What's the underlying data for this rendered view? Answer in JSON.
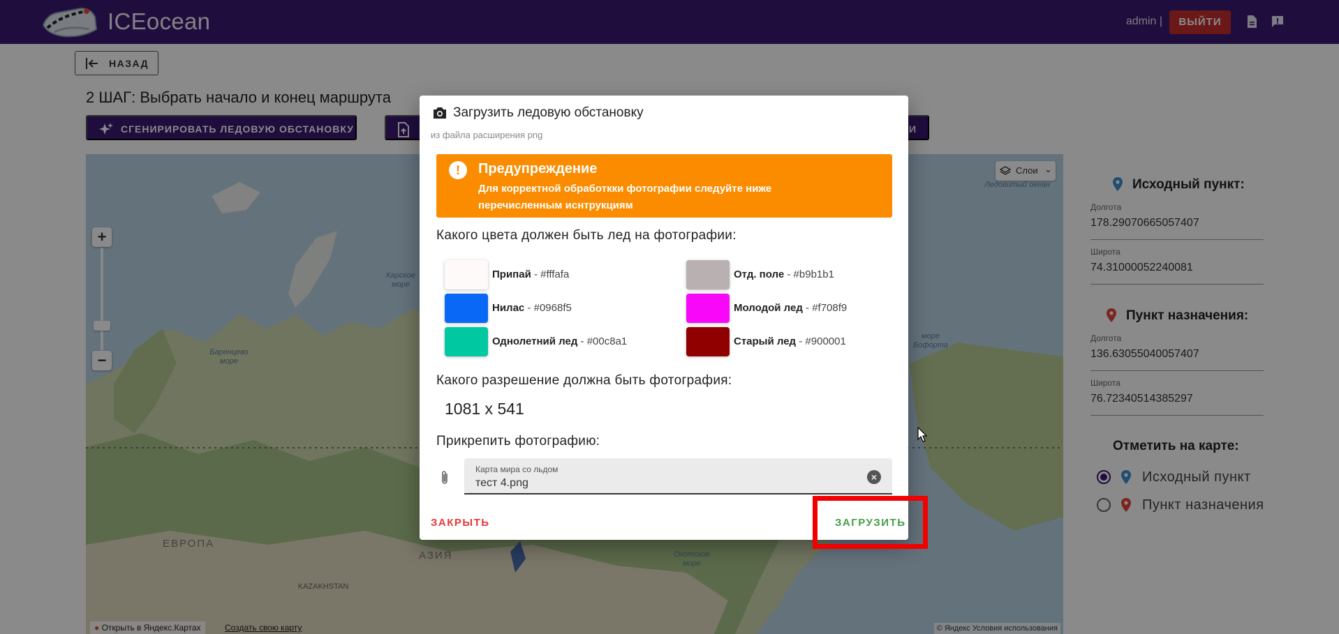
{
  "header": {
    "brand": "ICEocean",
    "user": "admin |",
    "logout_label": "ВЫЙТИ"
  },
  "page": {
    "back_label": "НАЗАД",
    "step_title": "2 ШАГ: Выбрать начало и конец маршрута",
    "generate_label": "СГЕНИРИРОВАТЬ ЛЕДОВУЮ ОБСТАНОВКУ",
    "upload_label_tail": "И"
  },
  "map": {
    "layers_label": "Слои",
    "labels": {
      "arctic": "Северный Ледовитый океан",
      "kara": "Карское море",
      "barents": "Баренцево море",
      "okhotsk": "Охотское море",
      "beaufort": "море Бофорта",
      "europe": "ЕВРОПА",
      "asia": "АЗИЯ",
      "kazakhstan": "KAZAKHSTAN"
    },
    "open_in_yandex": "Открыть в Яндекс.Картах",
    "create_map": "Создать свою карту",
    "copyright": "© Яндекс Условия использования"
  },
  "sidebar": {
    "origin_title": "Исходный пункт:",
    "origin_lon_label": "Долгота",
    "origin_lon": "178.29070665057407",
    "origin_lat_label": "Широта",
    "origin_lat": "74.31000052240081",
    "dest_title": "Пункт назначения:",
    "dest_lon_label": "Долгота",
    "dest_lon": "136.63055040057407",
    "dest_lat_label": "Широта",
    "dest_lat": "76.72340514385297",
    "mark_title": "Отметить на карте:",
    "radio_origin": "Исходный пункт",
    "radio_dest": "Пункт назначения",
    "origin_pin_color": "#3d8fd1",
    "dest_pin_color": "#e2463a"
  },
  "modal": {
    "title": "Загрузить ледовую обстановку",
    "subtitle": "из файла расширения png",
    "alert_title": "Предупреждение",
    "alert_text": "Для корректной обработкки фотографии следуйте ниже перечисленным иснтрукциям",
    "q_color": "Какого цвета должен быть лед на фотографии:",
    "colors": [
      {
        "name": "Припай",
        "code": "#fffafa"
      },
      {
        "name": "Отд. поле",
        "code": "#b9b1b1"
      },
      {
        "name": "Нилас",
        "code": "#0968f5"
      },
      {
        "name": "Молодой лед",
        "code": "#f708f9"
      },
      {
        "name": "Однолетний лед",
        "code": "#00c8a1"
      },
      {
        "name": "Старый лед",
        "code": "#900001"
      }
    ],
    "q_resolution": "Какого разрешение должна быть фотография:",
    "resolution": "1081 x 541",
    "q_attach": "Прикрепить фотографию:",
    "file_label": "Карта мира со льдом",
    "file_value": "тест 4.png",
    "close_label": "ЗАКРЫТЬ",
    "upload_label": "ЗАГРУЗИТЬ"
  }
}
